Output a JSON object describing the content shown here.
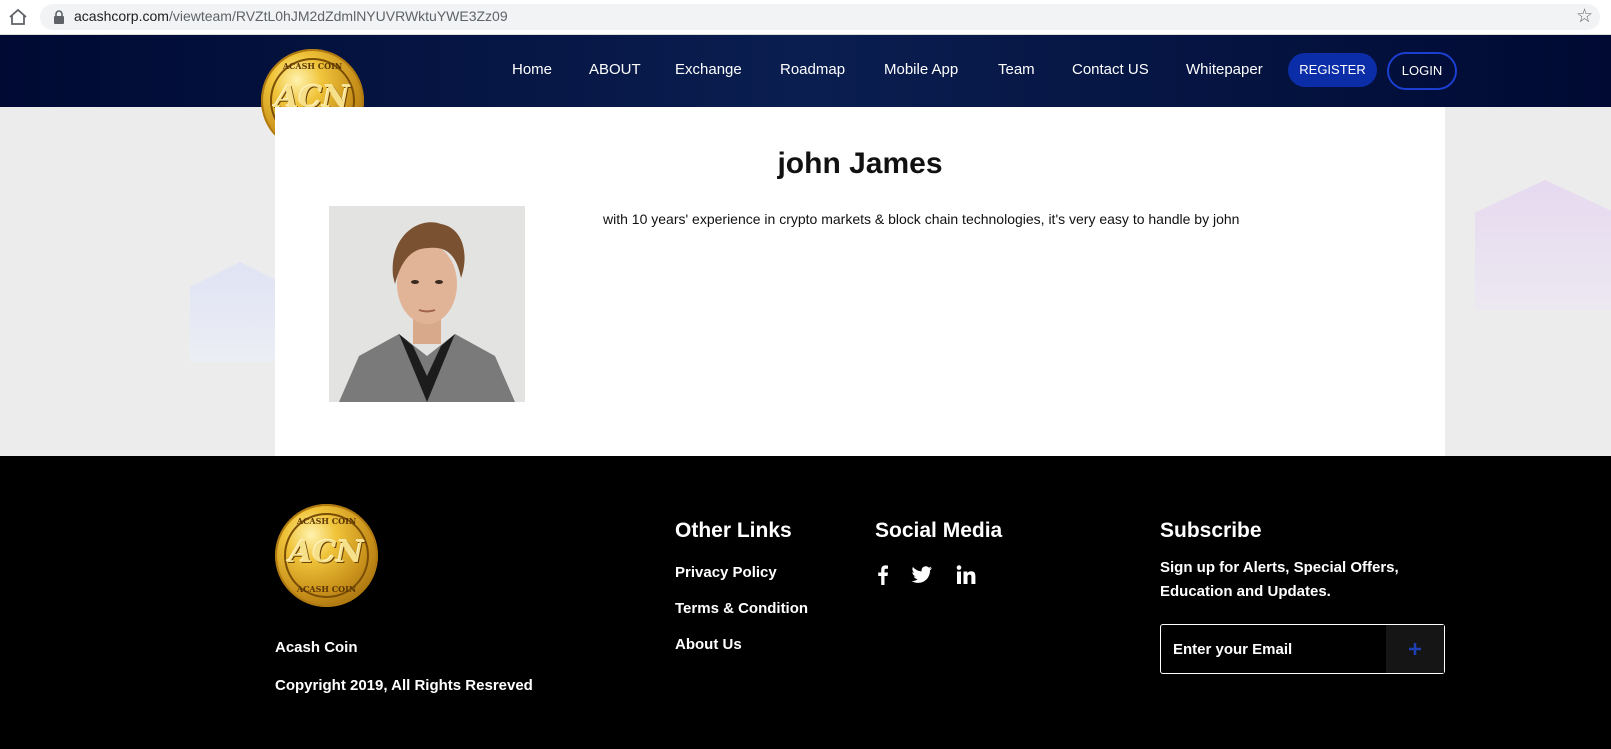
{
  "browser": {
    "url_domain": "acashcorp.com",
    "url_path": "/viewteam/RVZtL0hJM2dZdmlNYUVRWktuYWE3Zz09",
    "bookmark_icon": "star-icon"
  },
  "logo": {
    "top_text": "ACASH COIN",
    "mark": "ACN",
    "bottom_text": "ACASH COIN"
  },
  "nav": {
    "links": [
      "Home",
      "ABOUT",
      "Exchange",
      "Roadmap",
      "Mobile App",
      "Team",
      "Contact US",
      "Whitepaper"
    ],
    "register": "REGISTER",
    "login": "LOGIN"
  },
  "profile": {
    "name": "john James",
    "bio": "with 10 years' experience in crypto markets & block chain technologies, it's very easy to handle by john"
  },
  "footer": {
    "brand": "Acash Coin",
    "copyright": "Copyright 2019, All Rights Resreved",
    "other_links_title": "Other Links",
    "other_links": [
      "Privacy Policy",
      "Terms & Condition",
      "About Us"
    ],
    "social_title": "Social Media",
    "social_icons": [
      "facebook-icon",
      "twitter-icon",
      "linkedin-icon"
    ],
    "subscribe_title": "Subscribe",
    "subscribe_text": "Sign up for Alerts, Special Offers, Education and Updates.",
    "email_placeholder": "Enter your Email"
  },
  "colors": {
    "nav_bg": "#000a33",
    "register_bg": "#0b2ea8",
    "footer_bg": "#000000"
  }
}
